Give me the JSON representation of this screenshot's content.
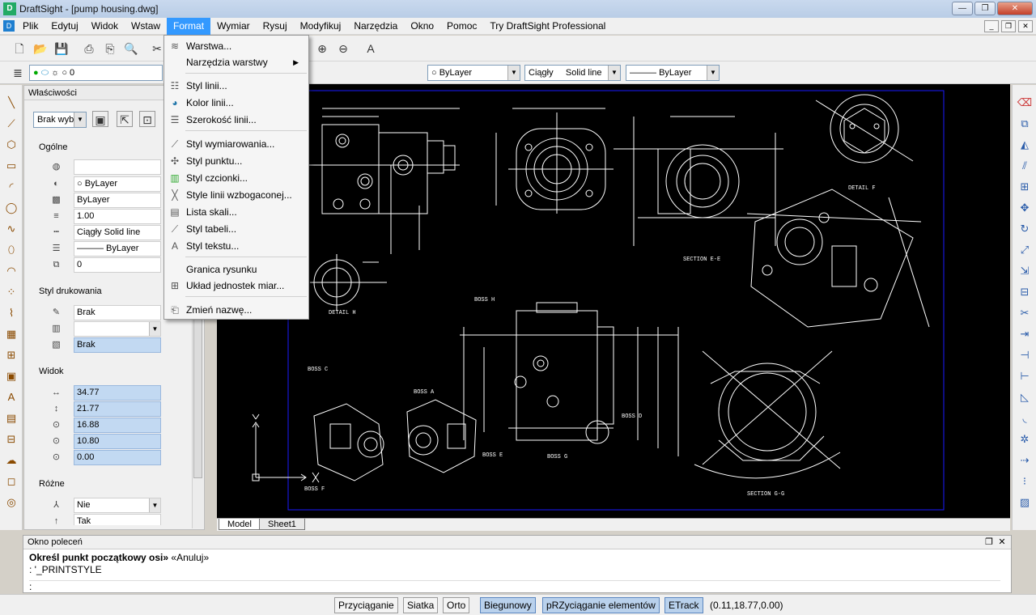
{
  "window": {
    "title": "DraftSight - [pump housing.dwg]"
  },
  "menubar": {
    "items": [
      "Plik",
      "Edytuj",
      "Widok",
      "Wstaw",
      "Format",
      "Wymiar",
      "Rysuj",
      "Modyfikuj",
      "Narzędzia",
      "Okno",
      "Pomoc",
      "Try DraftSight Professional"
    ],
    "active": "Format"
  },
  "toolbar2": {
    "layer_value": "0",
    "color_value": "ByLayer",
    "linetype_name": "Ciągły",
    "linetype_desc": "Solid line",
    "lineweight_value": "ByLayer"
  },
  "format_menu": {
    "items": [
      {
        "label": "Warstwa...",
        "icon": "layers-icon"
      },
      {
        "label": "Narzędzia warstwy",
        "icon": "none",
        "submenu": true
      },
      {
        "label": "Styl linii...",
        "icon": "linestyle-icon"
      },
      {
        "label": "Kolor linii...",
        "icon": "color-wheel-icon"
      },
      {
        "label": "Szerokość linii...",
        "icon": "lineweight-icon"
      },
      {
        "label": "Styl wymiarowania...",
        "icon": "dimstyle-icon"
      },
      {
        "label": "Styl punktu...",
        "icon": "point-icon"
      },
      {
        "label": "Styl czcionki...",
        "icon": "font-icon"
      },
      {
        "label": "Style linii wzbogaconej...",
        "icon": "multiline-icon"
      },
      {
        "label": "Lista skali...",
        "icon": "scale-list-icon"
      },
      {
        "label": "Styl tabeli...",
        "icon": "table-icon"
      },
      {
        "label": "Styl tekstu...",
        "icon": "text-style-icon"
      },
      {
        "label": "Granica rysunku",
        "icon": "none"
      },
      {
        "label": "Układ jednostek miar...",
        "icon": "units-icon"
      },
      {
        "label": "Zmień nazwę...",
        "icon": "rename-icon"
      }
    ]
  },
  "properties": {
    "title": "Właściwości",
    "selection": "Brak wyb",
    "groups": {
      "general": "Ogólne",
      "print_style": "Styl drukowania",
      "view": "Widok",
      "misc": "Różne"
    },
    "general_rows": [
      "",
      "ByLayer",
      "ByLayer",
      "1.00",
      "Ciągły      Solid line",
      "——— ByLayer",
      "0"
    ],
    "print_rows": [
      "Brak",
      "",
      "Brak"
    ],
    "view_rows": [
      "34.77",
      "21.77",
      "16.88",
      "10.80",
      "0.00"
    ],
    "misc_rows": [
      "Nie",
      "Tak"
    ]
  },
  "tabs": [
    "Model",
    "Sheet1"
  ],
  "command_window": {
    "title": "Okno poleceń",
    "prompt": "Określ punkt początkowy osi»",
    "option": "«Anuluj»",
    "history": ": '_PRINTSTYLE",
    "input_prefix": ":"
  },
  "statusbar": {
    "buttons": [
      {
        "label": "Przyciąganie",
        "on": false
      },
      {
        "label": "Siatka",
        "on": false
      },
      {
        "label": "Orto",
        "on": false
      },
      {
        "label": "Biegunowy",
        "on": true
      },
      {
        "label": "pRZyciąganie elementów",
        "on": true
      },
      {
        "label": "ETrack",
        "on": true
      }
    ],
    "coords": "(0.11,18.77,0.00)"
  },
  "drawing": {
    "labels": [
      "DETAIL F",
      "SECTION E-E",
      "DETAIL H",
      "SECTION G-G",
      "BOSS H",
      "BOSS A",
      "BOSS C",
      "BOSS F",
      "BOSS G",
      "BOSS E",
      "BOSS D"
    ]
  },
  "colors": {
    "canvas": "#000000",
    "lines": "#ffffff",
    "border": "#1a1aff",
    "menu_highlight": "#3399ff"
  }
}
